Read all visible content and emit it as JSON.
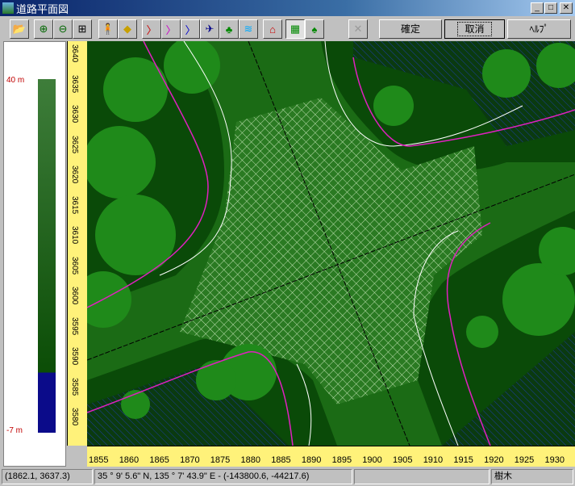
{
  "window": {
    "title": "道路平面図"
  },
  "toolbar": {
    "ok": "確定",
    "cancel": "取消",
    "help": "ﾍﾙﾌﾟ",
    "icons": [
      "open-folder-icon",
      "zoom-in-icon",
      "zoom-out-icon",
      "fit-view-icon",
      "surveyor-icon",
      "road-sign-icon",
      "polyline-red-icon",
      "polyline-magenta-icon",
      "polyline-blue-icon",
      "airplane-icon",
      "forest-icon",
      "water-icon",
      "house-line-icon",
      "road-map-icon",
      "tree-select-icon",
      "disabled-tool-icon"
    ]
  },
  "legend": {
    "max": "40 m",
    "min": "-7 m"
  },
  "ruler": {
    "y_ticks": [
      "3640",
      "3635",
      "3630",
      "3625",
      "3620",
      "3615",
      "3610",
      "3605",
      "3600",
      "3595",
      "3590",
      "3585",
      "3580"
    ],
    "x_ticks": [
      "1855",
      "1860",
      "1865",
      "1870",
      "1875",
      "1880",
      "1885",
      "1890",
      "1895",
      "1900",
      "1905",
      "1910",
      "1915",
      "1920",
      "1925",
      "1930"
    ]
  },
  "status": {
    "coords": "(1862.1, 3637.3)",
    "geo": "35 °  9' 5.6\" N, 135 °  7' 43.9\" E  -  (-143800.6, -44217.6)",
    "blank": "",
    "layer": "樹木"
  },
  "colors": {
    "ground": "#0a4a08",
    "road": "#1a6a14",
    "tree": "#1f8a1a",
    "water": "#0b2c6a",
    "ruler": "#fff27a"
  }
}
